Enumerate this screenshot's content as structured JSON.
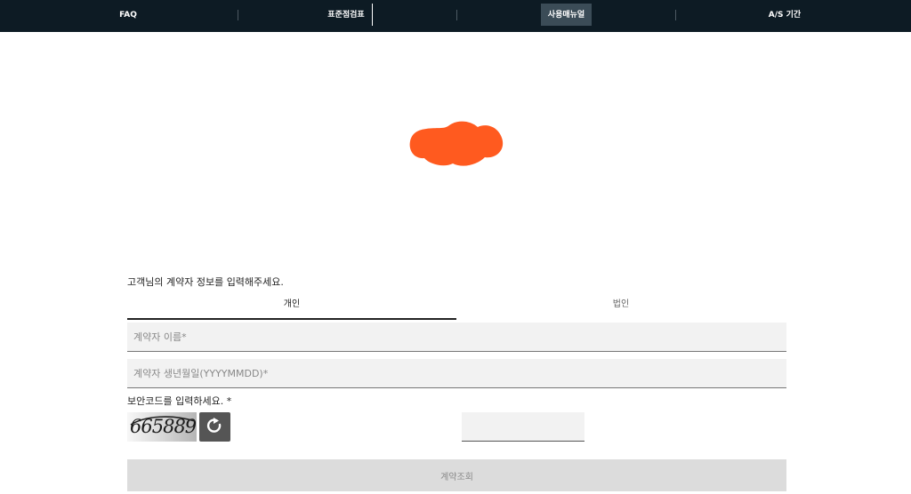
{
  "nav": {
    "items": [
      {
        "label": "FAQ"
      },
      {
        "label": "표준점검표"
      },
      {
        "label": "사용매뉴얼"
      },
      {
        "label": "A/S 기간"
      }
    ],
    "active_color": "#3b4c57"
  },
  "logo": {
    "color": "#ff5a1f"
  },
  "form": {
    "prompt": "고객님의 계약자 정보를 입력해주세요.",
    "tabs": [
      {
        "label": "개인",
        "selected": true
      },
      {
        "label": "법인",
        "selected": false
      }
    ],
    "name_placeholder": "계약자 이름*",
    "birth_placeholder": "계약자 생년월일(YYYYMMDD)*",
    "captcha_label": "보안코드를 입력하세요. *",
    "captcha_code": "665889",
    "captcha_input_value": "",
    "submit_label": "계약조회"
  }
}
